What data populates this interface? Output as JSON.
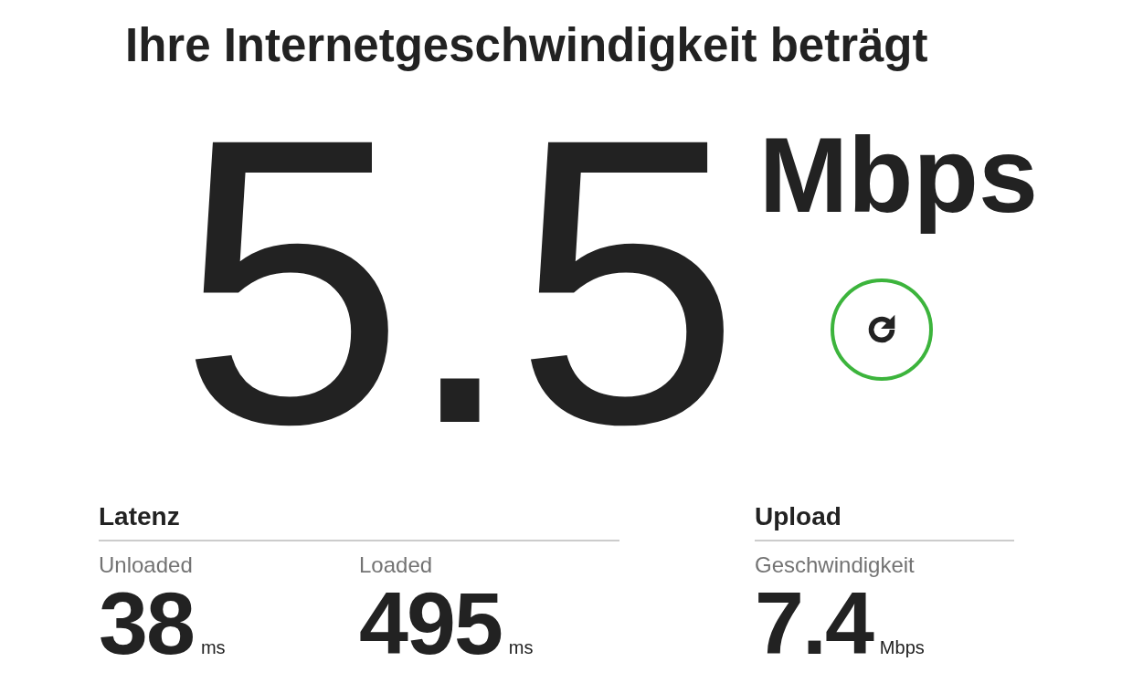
{
  "heading": "Ihre Internetgeschwindigkeit beträgt",
  "speed": {
    "value": "5.5",
    "unit": "Mbps"
  },
  "groups": [
    {
      "title": "Latenz",
      "metrics": [
        {
          "label": "Unloaded",
          "value": "38",
          "unit": "ms"
        },
        {
          "label": "Loaded",
          "value": "495",
          "unit": "ms"
        }
      ]
    },
    {
      "title": "Upload",
      "metrics": [
        {
          "label": "Geschwindigkeit",
          "value": "7.4",
          "unit": "Mbps"
        }
      ]
    }
  ]
}
